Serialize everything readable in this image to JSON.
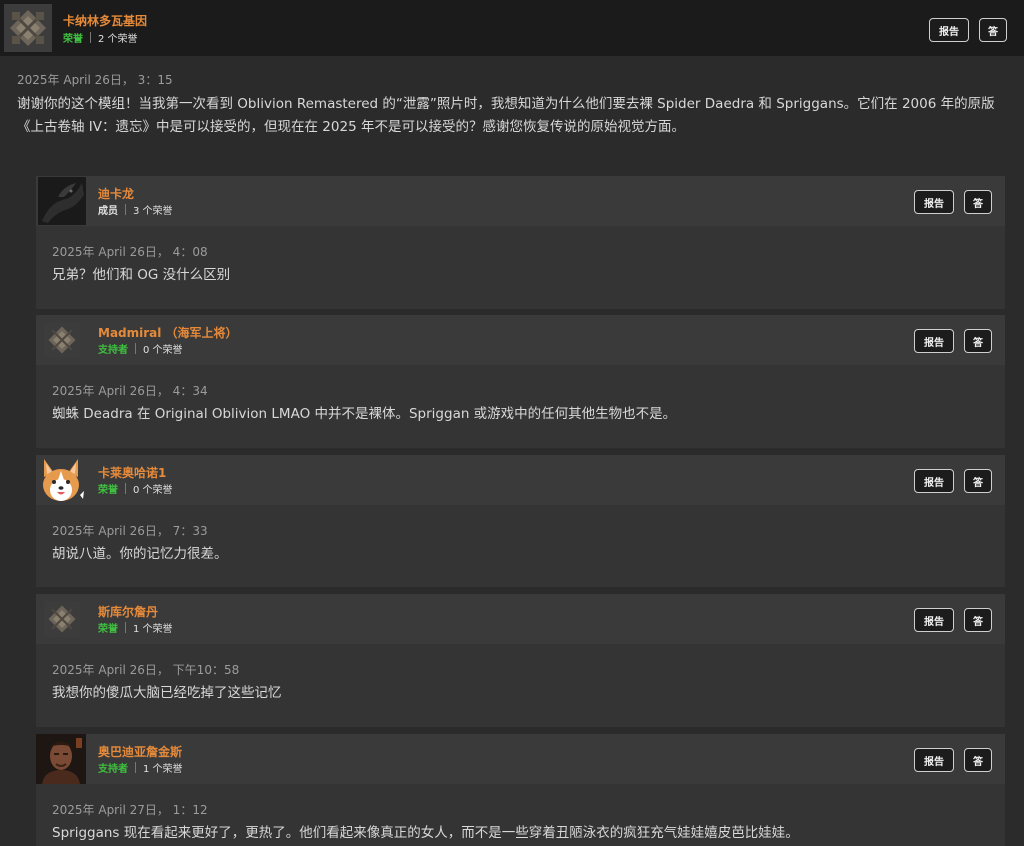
{
  "post": {
    "author": "卡纳林多瓦基因",
    "role": "荣誉",
    "honors": "2 个荣誉",
    "date": "2025年 April 26日， 3：15",
    "text": "谢谢你的这个模组！当我第一次看到 Oblivion Remastered 的“泄露”照片时，我想知道为什么他们要去裸 Spider Daedra 和 Spriggans。它们在 2006 年的原版《上古卷轴 IV：遗忘》中是可以接受的，但现在在 2025 年不是可以接受的？感谢您恢复传说的原始视觉方面。",
    "report_label": "报告",
    "reply_label": "答"
  },
  "replies": [
    {
      "author": "迪卡龙",
      "role": "成员",
      "honors": "3 个荣誉",
      "date": "2025年 April 26日， 4：08",
      "text": "兄弟？他们和 OG 没什么区别",
      "report_label": "报告",
      "reply_label": "答"
    },
    {
      "author": "Madmiral （海军上将）",
      "role": "支持者",
      "honors": "0 个荣誉",
      "date": "2025年 April 26日， 4：34",
      "text": "蜘蛛 Deadra 在 Original Oblivion LMAO 中并不是裸体。Spriggan 或游戏中的任何其他生物也不是。",
      "report_label": "报告",
      "reply_label": "答"
    },
    {
      "author": "卡莱奥哈诺1",
      "role": "荣誉",
      "honors": "0 个荣誉",
      "date": "2025年 April 26日， 7：33",
      "text": "胡说八道。你的记忆力很差。",
      "report_label": "报告",
      "reply_label": "答"
    },
    {
      "author": "斯库尔詹丹",
      "role": "荣誉",
      "honors": "1 个荣誉",
      "date": "2025年 April 26日， 下午10：58",
      "text": "我想你的傻瓜大脑已经吃掉了这些记忆",
      "report_label": "报告",
      "reply_label": "答"
    },
    {
      "author": "奥巴迪亚詹金斯",
      "role": "支持者",
      "honors": "1 个荣誉",
      "date": "2025年 April 27日， 1：12",
      "text": "Spriggans 现在看起来更好了，更热了。他们看起来像真正的女人，而不是一些穿着丑陋泳衣的疯狂充气娃娃嬉皮芭比娃娃。",
      "report_label": "报告",
      "reply_label": "答"
    }
  ],
  "colors": {
    "username": "#e58a3a",
    "role_green": "#3fbf3f",
    "page_bg": "#2b2b2b",
    "header_bg": "#1b1b1b",
    "reply_bg": "#343434",
    "reply_header_bg": "#3a3a3a"
  },
  "icons": {
    "default_avatar": "diamond-tile-avatar",
    "dragon_avatar": "dark-dragon-avatar",
    "corgi_avatar": "corgi-avatar",
    "person_avatar": "portrait-avatar"
  }
}
